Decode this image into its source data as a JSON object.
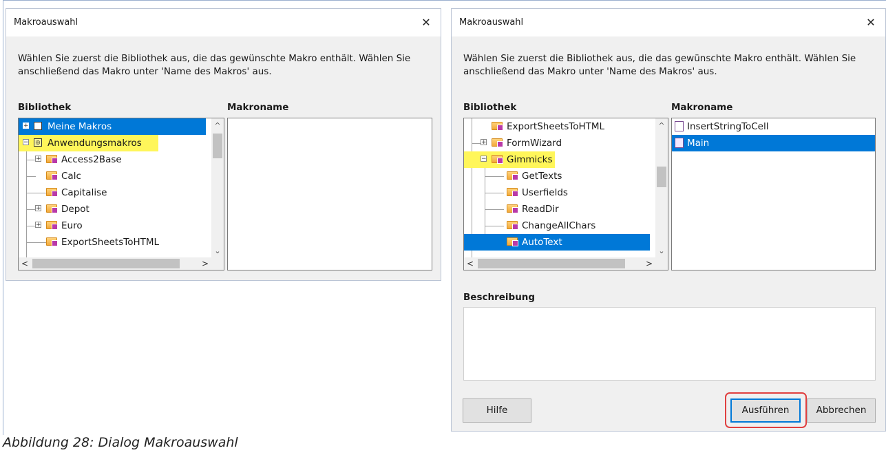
{
  "left_dialog": {
    "title": "Makroauswahl",
    "close_glyph": "✕",
    "description": "Wählen Sie zuerst die Bibliothek aus, die das gewünschte Makro enthält. Wählen Sie anschließend das Makro unter 'Name des Makros' aus.",
    "library_header": "Bibliothek",
    "macro_header": "Makroname",
    "tree": [
      {
        "label": "Meine Makros",
        "expander": "+",
        "selected": true
      },
      {
        "label": "Anwendungsmakros",
        "expander": "−",
        "highlighted": true
      },
      {
        "label": "Access2Base",
        "expander": "+"
      },
      {
        "label": "Calc"
      },
      {
        "label": "Capitalise"
      },
      {
        "label": "Depot",
        "expander": "+"
      },
      {
        "label": "Euro",
        "expander": "+"
      },
      {
        "label": "ExportSheetsToHTML"
      }
    ],
    "macros": []
  },
  "right_dialog": {
    "title": "Makroauswahl",
    "close_glyph": "✕",
    "description": "Wählen Sie zuerst die Bibliothek aus, die das gewünschte Makro enthält. Wählen Sie anschließend das Makro unter 'Name des Makros' aus.",
    "library_header": "Bibliothek",
    "macro_header": "Makroname",
    "tree": [
      {
        "label": "ExportSheetsToHTML"
      },
      {
        "label": "FormWizard",
        "expander": "+"
      },
      {
        "label": "Gimmicks",
        "expander": "−",
        "highlighted": true
      },
      {
        "label": "GetTexts"
      },
      {
        "label": "Userfields"
      },
      {
        "label": "ReadDir"
      },
      {
        "label": "ChangeAllChars"
      },
      {
        "label": "AutoText",
        "selected": true
      }
    ],
    "macros": [
      {
        "label": "InsertStringToCell"
      },
      {
        "label": "Main",
        "selected": true
      }
    ],
    "description_header": "Beschreibung",
    "help_button": "Hilfe",
    "run_button": "Ausführen",
    "cancel_button": "Abbrechen"
  },
  "scroll_glyphs": {
    "up": "^",
    "down": "⌄",
    "left": "<",
    "right": ">"
  },
  "caption": "Abbildung 28: Dialog Makroauswahl",
  "colors": {
    "selection": "#0078d7",
    "highlight": "#fff65a",
    "annotation": "#e04040"
  }
}
